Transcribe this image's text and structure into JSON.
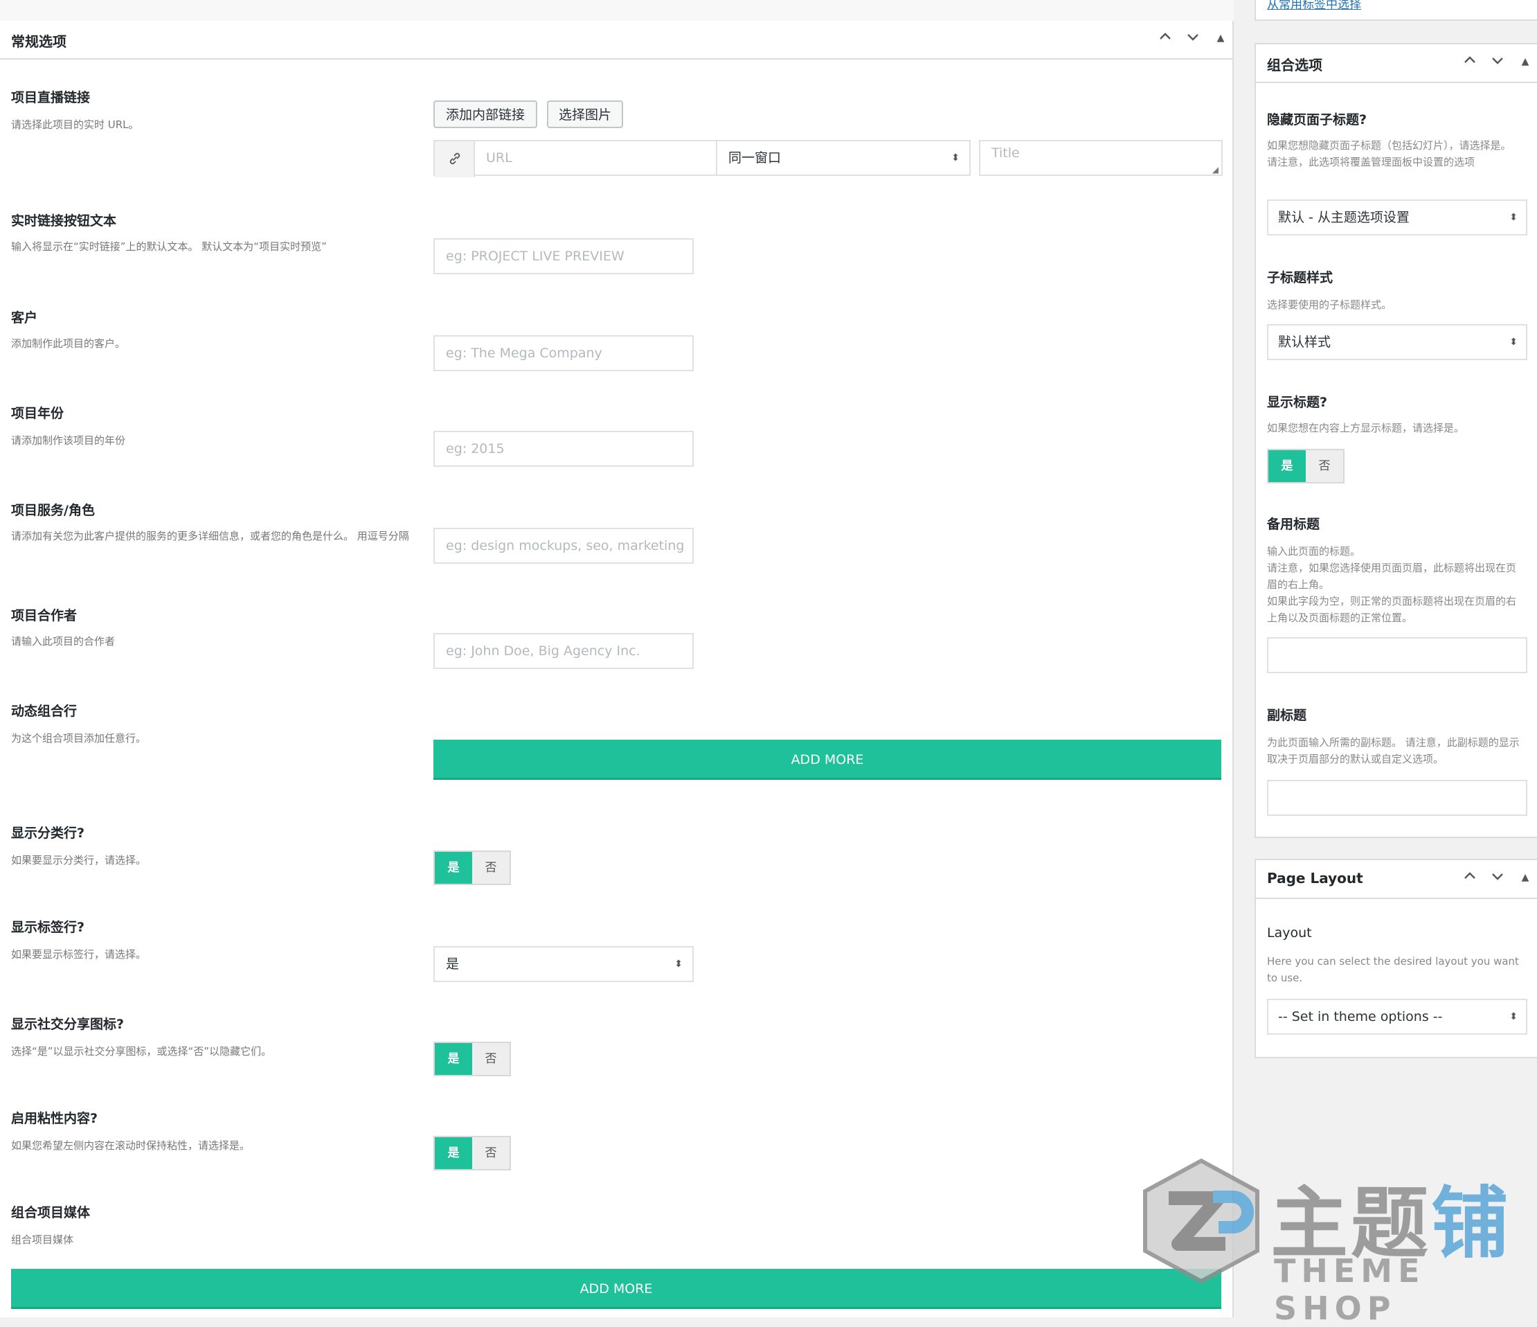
{
  "main": {
    "header_title": "常规选项",
    "fields": {
      "live_link": {
        "title": "项目直播链接",
        "desc": "请选择此项目的实时 URL。",
        "btn_internal": "添加内部链接",
        "btn_image": "选择图片",
        "url_placeholder": "URL",
        "target_value": "同一窗口",
        "title_placeholder": "Title"
      },
      "live_button_text": {
        "title": "实时链接按钮文本",
        "desc": "输入将显示在“实时链接”上的默认文本。 默认文本为“项目实时预览”",
        "placeholder": "eg: PROJECT LIVE PREVIEW"
      },
      "client": {
        "title": "客户",
        "desc": "添加制作此项目的客户。",
        "placeholder": "eg: The Mega Company"
      },
      "year": {
        "title": "项目年份",
        "desc": "请添加制作该项目的年份",
        "placeholder": "eg: 2015"
      },
      "services": {
        "title": "项目服务/角色",
        "desc": "请添加有关您为此客户提供的服务的更多详细信息，或者您的角色是什么。 用逗号分隔",
        "placeholder": "eg: design mockups, seo, marketing"
      },
      "collaborators": {
        "title": "项目合作者",
        "desc": "请输入此项目的合作者",
        "placeholder": "eg: John Doe, Big Agency Inc."
      },
      "dynamic_rows": {
        "title": "动态组合行",
        "desc": "为这个组合项目添加任意行。",
        "button": "ADD MORE"
      },
      "show_categories": {
        "title": "显示分类行?",
        "desc": "如果要显示分类行，请选择。",
        "yes": "是",
        "no": "否"
      },
      "show_tags": {
        "title": "显示标签行?",
        "desc": "如果要显示标签行，请选择。",
        "value": "是"
      },
      "show_social": {
        "title": "显示社交分享图标?",
        "desc": "选择“是”以显示社交分享图标，或选择“否”以隐藏它们。",
        "yes": "是",
        "no": "否"
      },
      "sticky": {
        "title": "启用粘性内容?",
        "desc": "如果您希望左侧内容在滚动时保持粘性，请选择是。",
        "yes": "是",
        "no": "否"
      },
      "media": {
        "title": "组合项目媒体",
        "desc": "组合项目媒体",
        "button": "ADD MORE"
      }
    }
  },
  "sidebar": {
    "top_link": "从常用标签中选择",
    "combo": {
      "header_title": "组合选项",
      "hide_subtitle": {
        "title": "隐藏页面子标题?",
        "desc": "如果您想隐藏页面子标题（包括幻灯片），请选择是。 请注意，此选项将覆盖管理面板中设置的选项",
        "value": "默认 - 从主题选项设置"
      },
      "subtitle_style": {
        "title": "子标题样式",
        "desc": "选择要使用的子标题样式。",
        "value": "默认样式"
      },
      "show_title": {
        "title": "显示标题?",
        "desc": "如果您想在内容上方显示标题，请选择是。",
        "yes": "是",
        "no": "否"
      },
      "alt_title": {
        "title": "备用标题",
        "desc": "输入此页面的标题。\n请注意，如果您选择使用页面页眉，此标题将出现在页眉的右上角。\n如果此字段为空，则正常的页面标题将出现在页眉的右上角以及页面标题的正常位置。"
      },
      "subtitle": {
        "title": "副标题",
        "desc": "为此页面输入所需的副标题。 请注意，此副标题的显示取决于页眉部分的默认或自定义选项。"
      }
    },
    "layout": {
      "header_title": "Page Layout",
      "title": "Layout",
      "desc": "Here you can select the desired layout you want to use.",
      "value": "-- Set in theme options --"
    }
  },
  "watermark": {
    "cn_gray": "主题",
    "cn_blue": "铺",
    "en": "THEME SHOP"
  },
  "colors": {
    "accent": "#1fc19a",
    "border": "#dcdcde",
    "muted_text": "#777777"
  }
}
